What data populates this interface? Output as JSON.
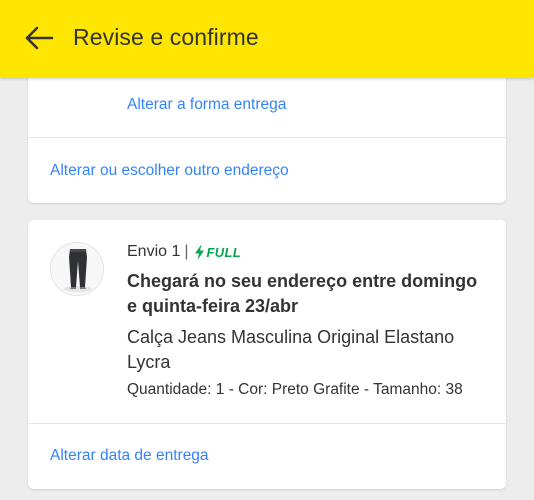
{
  "header": {
    "title": "Revise e confirme",
    "background_color": "#ffe600",
    "back_icon": "arrow-left-icon"
  },
  "address_card": {
    "change_delivery_method_link": "Alterar a forma entrega",
    "change_address_link": "Alterar ou escolher outro endereço"
  },
  "shipment_card": {
    "shipment_label": "Envio 1",
    "separator": "|",
    "badge_label": "FULL",
    "badge_icon": "lightning-bolt-icon",
    "badge_color": "#00a650",
    "delivery_estimate": "Chegará no seu endereço entre domingo e quinta-feira 23/abr",
    "product_title": "Calça Jeans Masculina Original Elastano Lycra",
    "product_details": "Quantidade: 1 - Cor: Preto Grafite - Tamanho: 38",
    "change_date_link": "Alterar data de entrega"
  },
  "colors": {
    "link": "#3483fa",
    "text": "#333333",
    "page_background": "#ededed"
  }
}
